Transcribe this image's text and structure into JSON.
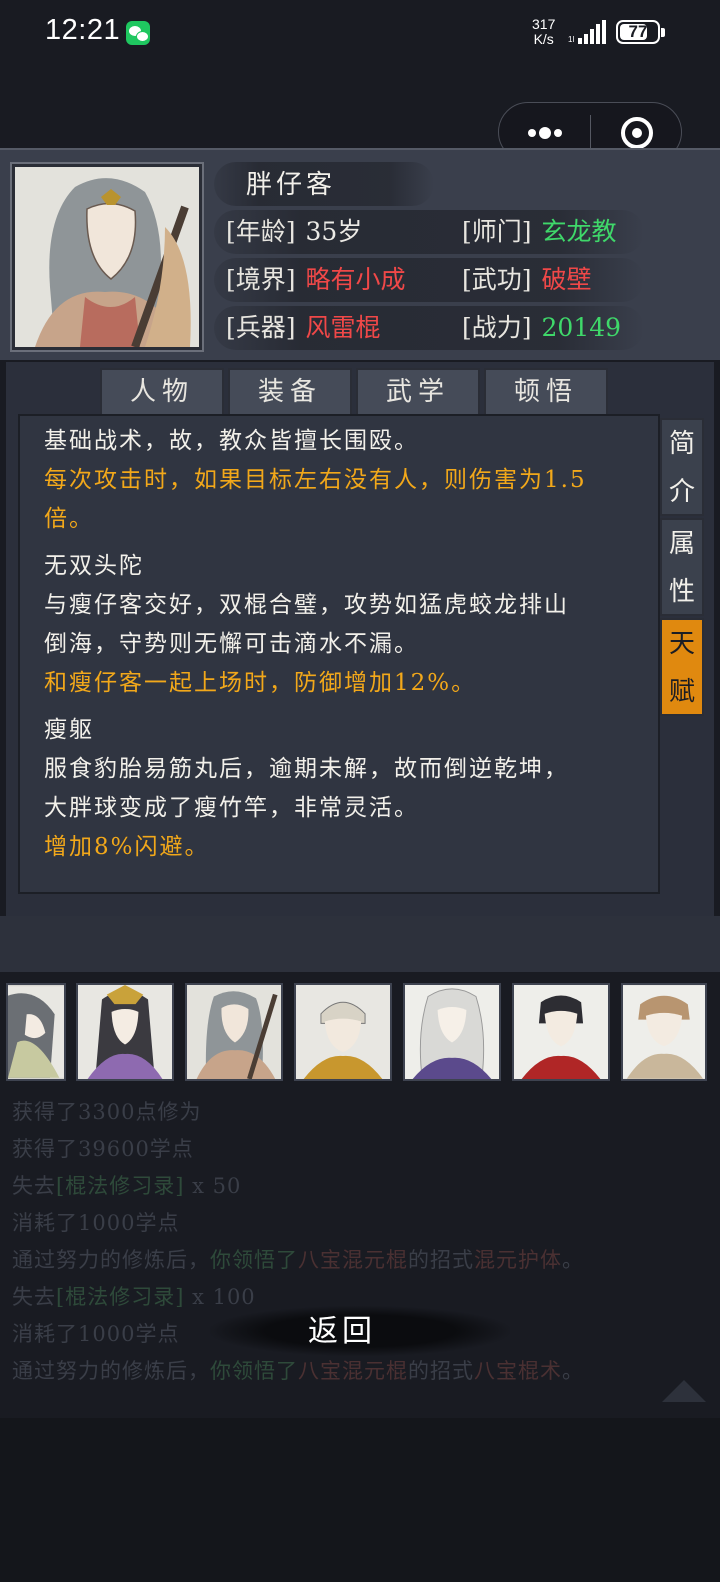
{
  "status_bar": {
    "time": "12:21",
    "net_speed_value": "317",
    "net_speed_unit": "K/s",
    "battery": "77",
    "battery_level": 0.77
  },
  "character": {
    "name": "胖仔客",
    "attributes": [
      {
        "label": "[年龄]",
        "value": "35岁",
        "color": "#ecebe6"
      },
      {
        "label": "[师门]",
        "value": "玄龙教",
        "color": "#3fd86a"
      },
      {
        "label": "[境界]",
        "value": "略有小成",
        "color": "#f04848"
      },
      {
        "label": "[武功]",
        "value": "破壁",
        "color": "#f04848"
      },
      {
        "label": "[兵器]",
        "value": "风雷棍",
        "color": "#f04848"
      },
      {
        "label": "[战力]",
        "value": "20149",
        "color": "#3fd86a"
      }
    ]
  },
  "tabs": [
    "人物",
    "装备",
    "武学",
    "顿悟"
  ],
  "side_tabs": [
    {
      "label_top": "简",
      "label_bottom": "介",
      "active": false
    },
    {
      "label_top": "属",
      "label_bottom": "性",
      "active": false
    },
    {
      "label_top": "天",
      "label_bottom": "赋",
      "active": true
    }
  ],
  "talents": {
    "lines": [
      {
        "text": "基础战术，故，教众皆擅长围殴。",
        "style": "white"
      },
      {
        "text": "每次攻击时，如果目标左右没有人，则伤害为1.5",
        "style": "gold"
      },
      {
        "text": "倍。",
        "style": "gold"
      },
      {
        "text": "",
        "style": "gap"
      },
      {
        "text": "无双头陀",
        "style": "white"
      },
      {
        "text": "与瘦仔客交好，双棍合璧，攻势如猛虎蛟龙排山",
        "style": "white"
      },
      {
        "text": "倒海，守势则无懈可击滴水不漏。",
        "style": "white"
      },
      {
        "text": "和瘦仔客一起上场时，防御增加12%。",
        "style": "gold"
      },
      {
        "text": "",
        "style": "gap"
      },
      {
        "text": "瘦躯",
        "style": "white"
      },
      {
        "text": "服食豹胎易筋丸后，逾期未解，故而倒逆乾坤，",
        "style": "white"
      },
      {
        "text": "大胖球变成了瘦竹竿，非常灵活。",
        "style": "white"
      },
      {
        "text": "增加8%闪避。",
        "style": "gold"
      }
    ]
  },
  "log_lines": [
    [
      {
        "t": "获得了3300点修为",
        "c": ""
      }
    ],
    [
      {
        "t": "获得了39600学点",
        "c": ""
      }
    ],
    [
      {
        "t": "失去",
        "c": ""
      },
      {
        "t": "[棍法修习录]",
        "c": "hl-a"
      },
      {
        "t": " x 50",
        "c": ""
      }
    ],
    [
      {
        "t": "消耗了1000学点",
        "c": ""
      }
    ],
    [
      {
        "t": "通过努力的修炼后，",
        "c": ""
      },
      {
        "t": "你领悟了",
        "c": "hl-a"
      },
      {
        "t": "八宝混元棍",
        "c": "hl-b"
      },
      {
        "t": "的招式",
        "c": ""
      },
      {
        "t": "混元护体",
        "c": "hl-b"
      },
      {
        "t": "。",
        "c": ""
      }
    ],
    [
      {
        "t": "失去",
        "c": ""
      },
      {
        "t": "[棍法修习录]",
        "c": "hl-a"
      },
      {
        "t": " x 100",
        "c": ""
      }
    ],
    [
      {
        "t": "消耗了1000学点",
        "c": ""
      }
    ],
    [
      {
        "t": "通过努力的修炼后，",
        "c": ""
      },
      {
        "t": "你领悟了",
        "c": "hl-a"
      },
      {
        "t": "八宝混元棍",
        "c": "hl-b"
      },
      {
        "t": "的招式",
        "c": ""
      },
      {
        "t": "八宝棍术",
        "c": "hl-b"
      },
      {
        "t": "。",
        "c": ""
      }
    ]
  ],
  "back_label": "返回",
  "strip_icons": [
    "portrait-1",
    "portrait-2",
    "portrait-3",
    "portrait-4",
    "portrait-5",
    "portrait-6",
    "portrait-7"
  ]
}
